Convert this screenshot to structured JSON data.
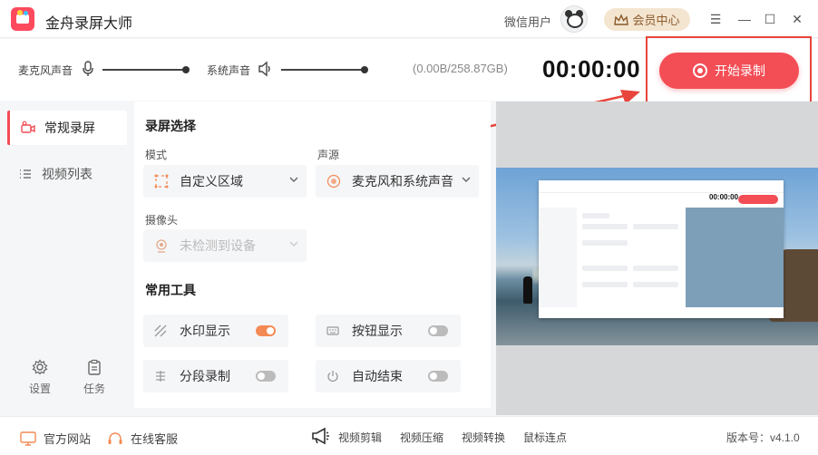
{
  "app": {
    "title": "金舟录屏大师",
    "user_name": "微信用户",
    "vip_label": "会员中心"
  },
  "audio": {
    "mic_label": "麦克风声音",
    "mic_level": 1.0,
    "system_label": "系统声音",
    "system_level": 1.0,
    "storage": "(0.00B/258.87GB)",
    "timer": "00:00:00",
    "start_label": "开始录制"
  },
  "nav": {
    "items": [
      {
        "label": "常规录屏",
        "active": true
      },
      {
        "label": "视频列表",
        "active": false
      }
    ],
    "settings_label": "设置",
    "tasks_label": "任务"
  },
  "main": {
    "select_title": "录屏选择",
    "mode_label": "模式",
    "mode_value": "自定义区域",
    "source_label": "声源",
    "source_value": "麦克风和系统声音",
    "camera_label": "摄像头",
    "camera_value": "未检测到设备",
    "tools_title": "常用工具",
    "tools": [
      {
        "label": "水印显示",
        "on": true
      },
      {
        "label": "按钮显示",
        "on": false
      },
      {
        "label": "分段录制",
        "on": false
      },
      {
        "label": "自动结束",
        "on": false
      }
    ]
  },
  "footer": {
    "website": "官方网站",
    "support": "在线客服",
    "tools": [
      "视频剪辑",
      "视频压缩",
      "视频转换",
      "鼠标连点"
    ],
    "version": "版本号：v4.1.0"
  },
  "colors": {
    "accent": "#f34d55",
    "toggle_on": "#f38a55",
    "annotation": "#e8453c"
  }
}
